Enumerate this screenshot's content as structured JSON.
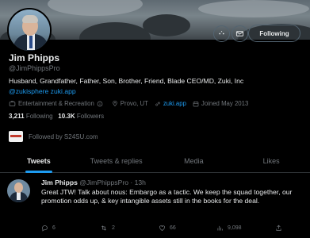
{
  "profile": {
    "name": "Jim Phipps",
    "handle": "@JimPhippsPro",
    "bio": "Husband, Grandfather, Father, Son, Brother, Friend, Blade CEO/MD, Zuki, Inc",
    "bio_link": "@zukisphere zuki.app",
    "category": "Entertainment & Recreation",
    "location": "Provo, UT",
    "website": "zuki.app",
    "joined": "Joined May 2013",
    "following_count": "3,211",
    "following_label": "Following",
    "followers_count": "10.3K",
    "followers_label": "Followers",
    "followed_by": "Followed by S24SU.com",
    "follow_button": "Following"
  },
  "tabs": [
    {
      "label": "Tweets",
      "active": true
    },
    {
      "label": "Tweets & replies",
      "active": false
    },
    {
      "label": "Media",
      "active": false
    },
    {
      "label": "Likes",
      "active": false
    }
  ],
  "tweet": {
    "author": "Jim Phipps",
    "handle": "@JimPhippsPro",
    "time": "13h",
    "text": "Great JTW! Talk about nous: Embargo as a tactic. We keep the squad together, our promotion odds up, & key intangible assets still in the books for the deal.",
    "replies": "6",
    "retweets": "2",
    "likes": "66",
    "views": "9,098"
  },
  "colors": {
    "accent": "#1d9bf0",
    "background": "#000000",
    "muted": "#71767b",
    "text": "#e7e9ea"
  }
}
